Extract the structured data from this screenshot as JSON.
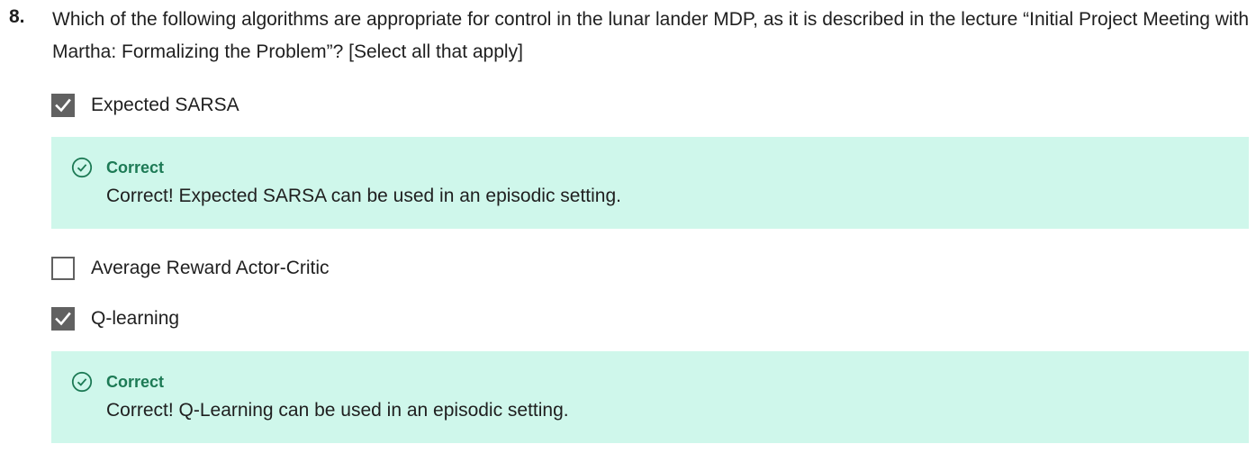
{
  "question": {
    "number": "8.",
    "text": "Which of the following algorithms are appropriate for control in the lunar lander MDP, as it is described in the lecture “Initial Project Meeting with Martha: Formalizing the Problem”? [Select all that apply]"
  },
  "options": [
    {
      "label": "Expected SARSA",
      "checked": true,
      "feedback": {
        "title": "Correct",
        "text": "Correct! Expected SARSA can be used in an episodic setting.",
        "icon": "check-circle-icon"
      }
    },
    {
      "label": "Average Reward Actor-Critic",
      "checked": false
    },
    {
      "label": "Q-learning",
      "checked": true,
      "feedback": {
        "title": "Correct",
        "text": "Correct! Q-Learning can be used in an episodic setting.",
        "icon": "check-circle-icon"
      }
    }
  ],
  "colors": {
    "checkbox_fill": "#616161",
    "feedback_bg": "#cff7eb",
    "feedback_accent": "#1d7a55"
  }
}
